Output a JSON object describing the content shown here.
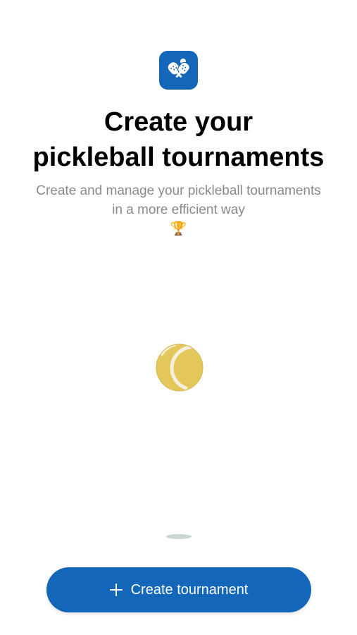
{
  "app": {
    "icon": "pickleball-paddles-icon",
    "accent_color": "#1467b8"
  },
  "onboarding": {
    "title_line1": "Create your",
    "title_line2": "pickleball tournaments",
    "subtitle_line1": "Create and manage your pickleball tournaments",
    "subtitle_line2": "in a more efficient way",
    "subtitle_emoji": "🏆"
  },
  "illustration": {
    "icon": "tennis-ball-icon",
    "ball_color": "#e3c75a"
  },
  "cta": {
    "icon": "plus-icon",
    "label": "Create tournament"
  }
}
